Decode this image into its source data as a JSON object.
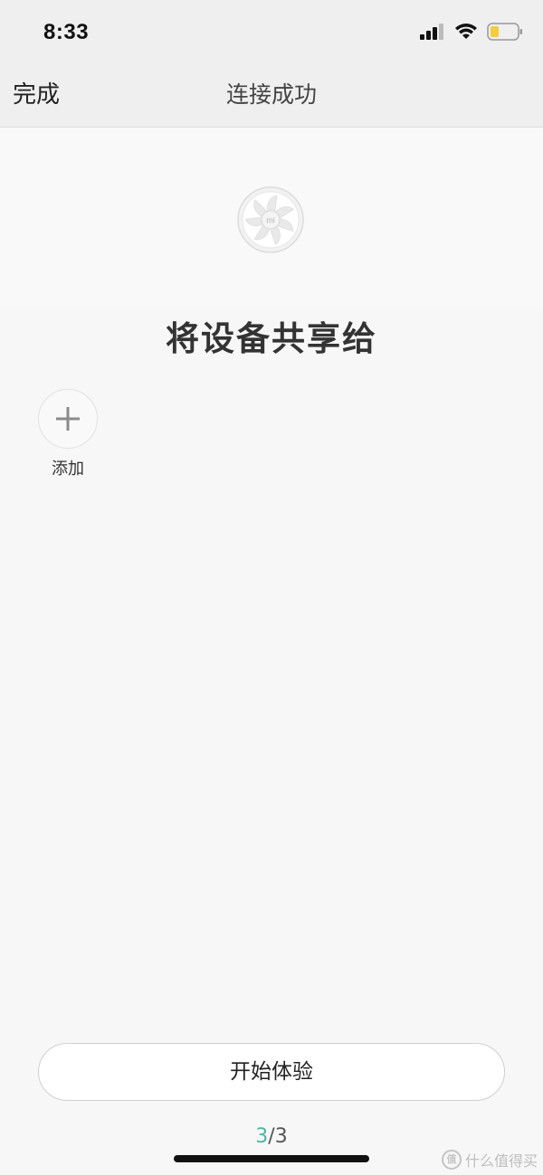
{
  "status_bar": {
    "time": "8:33",
    "icons": [
      "cellular-signal-icon",
      "wifi-icon",
      "battery-icon"
    ],
    "battery_color": "#f3cc3f"
  },
  "nav": {
    "done_label": "完成",
    "title": "连接成功"
  },
  "device": {
    "icon": "fan-device-icon",
    "logo_text": "mi"
  },
  "share": {
    "title": "将设备共享给",
    "add_label": "添加",
    "add_icon": "plus-icon"
  },
  "footer": {
    "start_label": "开始体验",
    "page_current": "3",
    "page_total": "/3",
    "accent_color": "#4eb6a0"
  },
  "watermark": {
    "badge": "值",
    "text": "什么值得买"
  }
}
